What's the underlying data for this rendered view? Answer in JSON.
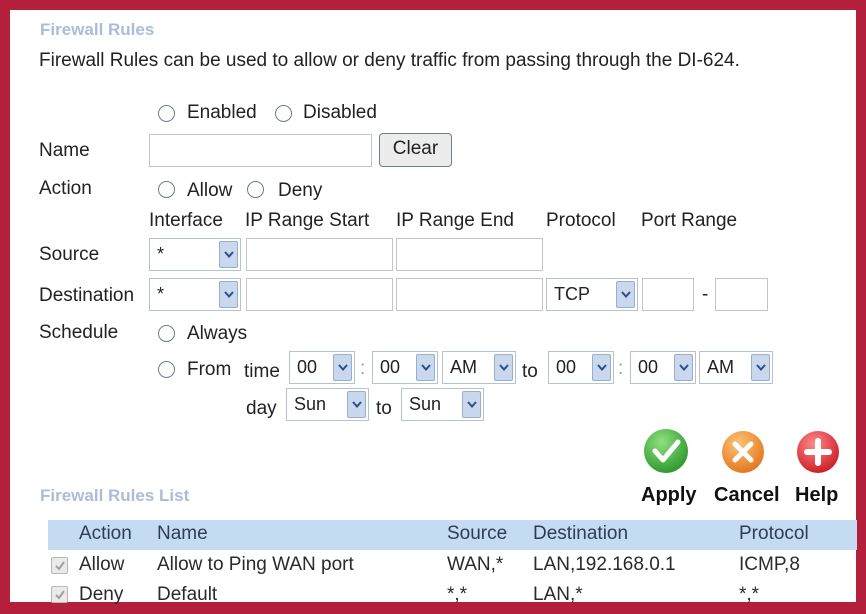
{
  "page": {
    "title": "Firewall Rules",
    "description": "Firewall Rules can be used to allow or deny traffic from passing through the DI-624."
  },
  "form": {
    "status_enabled": "Enabled",
    "status_disabled": "Disabled",
    "name_label": "Name",
    "name_value": "",
    "clear_label": "Clear",
    "action_label": "Action",
    "action_allow": "Allow",
    "action_deny": "Deny",
    "col_interface": "Interface",
    "col_ip_start": "IP Range Start",
    "col_ip_end": "IP Range End",
    "col_protocol": "Protocol",
    "col_port_range": "Port Range",
    "source_label": "Source",
    "source_interface": "*",
    "destination_label": "Destination",
    "destination_interface": "*",
    "destination_protocol": "TCP",
    "port_dash": "-",
    "schedule_label": "Schedule",
    "schedule_always": "Always",
    "schedule_from": "From",
    "time_label": "time",
    "time_from_hour": "00",
    "time_from_minute": "00",
    "time_from_ampm": "AM",
    "to_label": "to",
    "time_to_hour": "00",
    "time_to_minute": "00",
    "time_to_ampm": "AM",
    "colon": ":",
    "day_label": "day",
    "day_from": "Sun",
    "day_to": "Sun"
  },
  "actions": {
    "apply": "Apply",
    "cancel": "Cancel",
    "help": "Help"
  },
  "list": {
    "title": "Firewall Rules List",
    "headers": {
      "action": "Action",
      "name": "Name",
      "source": "Source",
      "destination": "Destination",
      "protocol": "Protocol"
    },
    "rows": [
      {
        "checked": true,
        "action": "Allow",
        "name": "Allow to Ping WAN port",
        "source": "WAN,*",
        "destination": "LAN,192.168.0.1",
        "protocol": "ICMP,8"
      },
      {
        "checked": true,
        "action": "Deny",
        "name": "Default",
        "source": "*,*",
        "destination": "LAN,*",
        "protocol": "*,*"
      }
    ]
  },
  "colors": {
    "frame": "#b4203b",
    "title": "#a9bdd8",
    "list_header_bg": "#c4dbf1",
    "apply": "#3aa83a",
    "cancel": "#e8822a",
    "help": "#d9262d"
  },
  "icons": {
    "apply": "checkmark-icon",
    "cancel": "x-icon",
    "help": "plus-icon"
  }
}
